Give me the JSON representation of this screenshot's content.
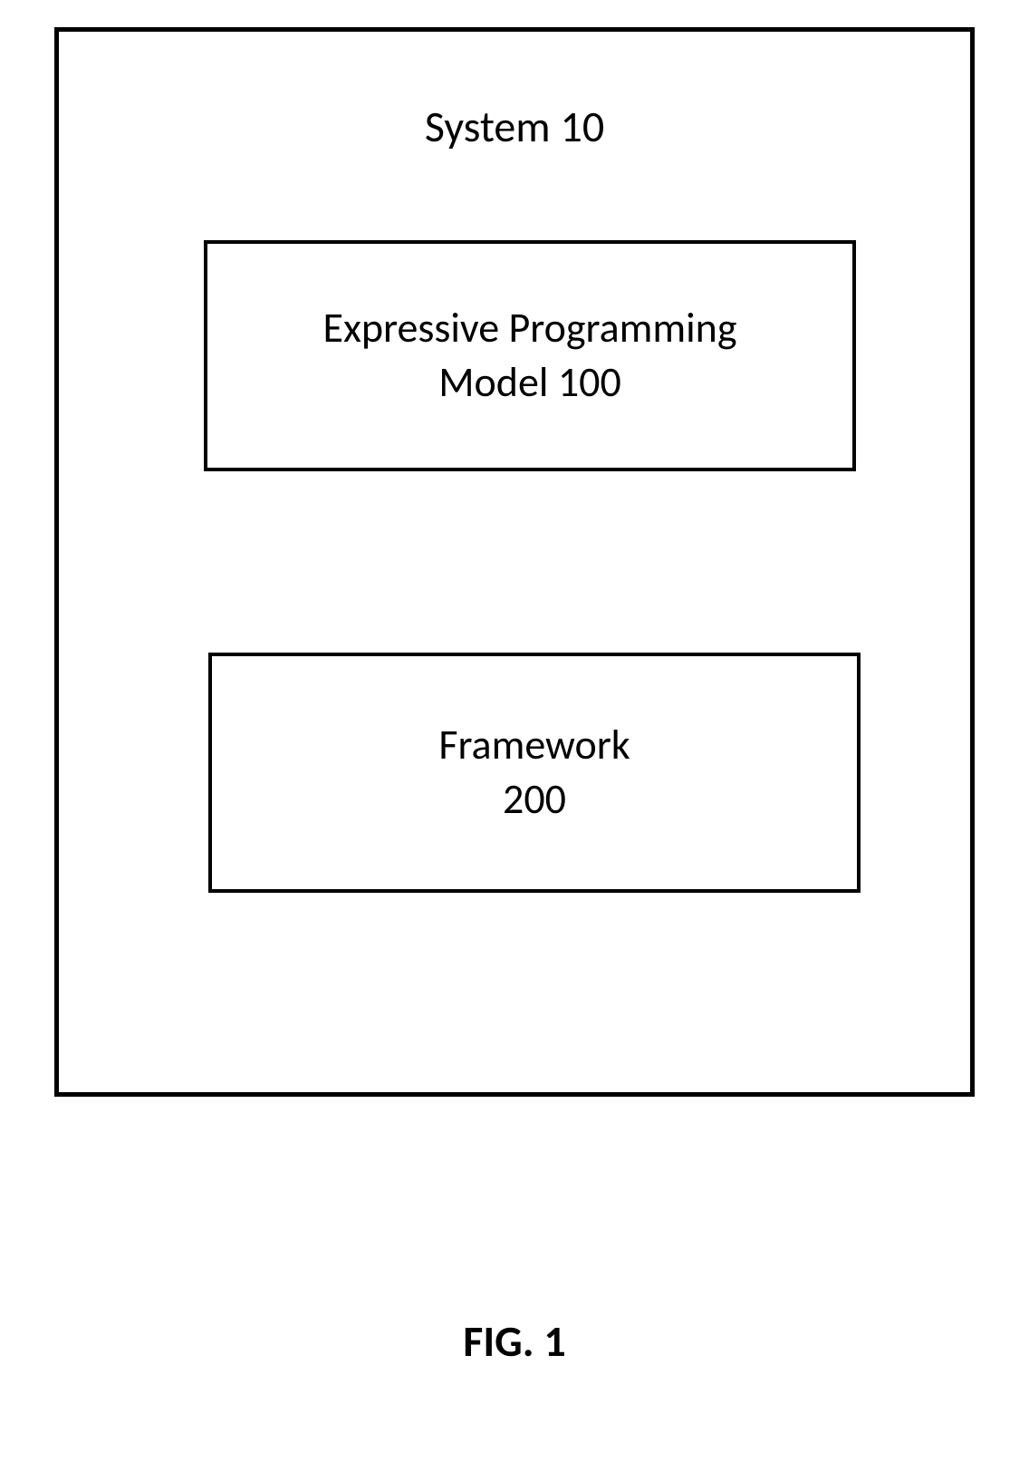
{
  "diagram": {
    "system_title": "System 10",
    "box1": {
      "line1": "Expressive Programming",
      "line2": "Model 100"
    },
    "box2": {
      "line1": "Framework",
      "line2": "200"
    },
    "figure_label": "FIG. 1"
  }
}
